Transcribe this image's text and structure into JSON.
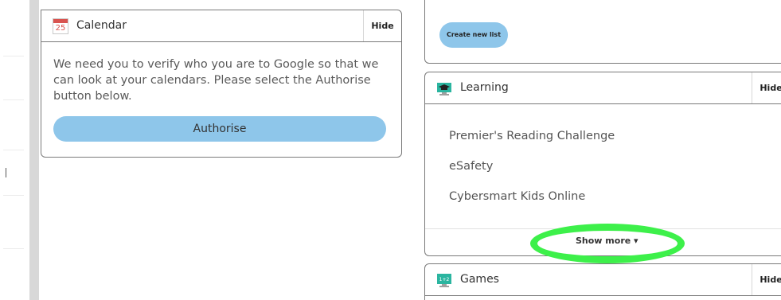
{
  "calendar": {
    "icon_day": "25",
    "title": "Calendar",
    "hide_label": "Hide",
    "message": "We need you to verify who you are to Google so that we can look at your calendars. Please select the Authorise button below.",
    "authorise_label": "Authorise"
  },
  "lists": {
    "create_label": "Create new list"
  },
  "learning": {
    "title": "Learning",
    "hide_label": "Hide",
    "items": [
      "Premier's Reading Challenge",
      "eSafety",
      "Cybersmart Kids Online"
    ],
    "show_more_label": "Show more ▾"
  },
  "games": {
    "icon_text": "1+2",
    "title": "Games",
    "hide_label": "Hide"
  },
  "colors": {
    "button_blue": "#8ec6ea",
    "highlight_green": "#3df04a",
    "calendar_red": "#d9534f",
    "icon_teal": "#2bb5a0"
  }
}
